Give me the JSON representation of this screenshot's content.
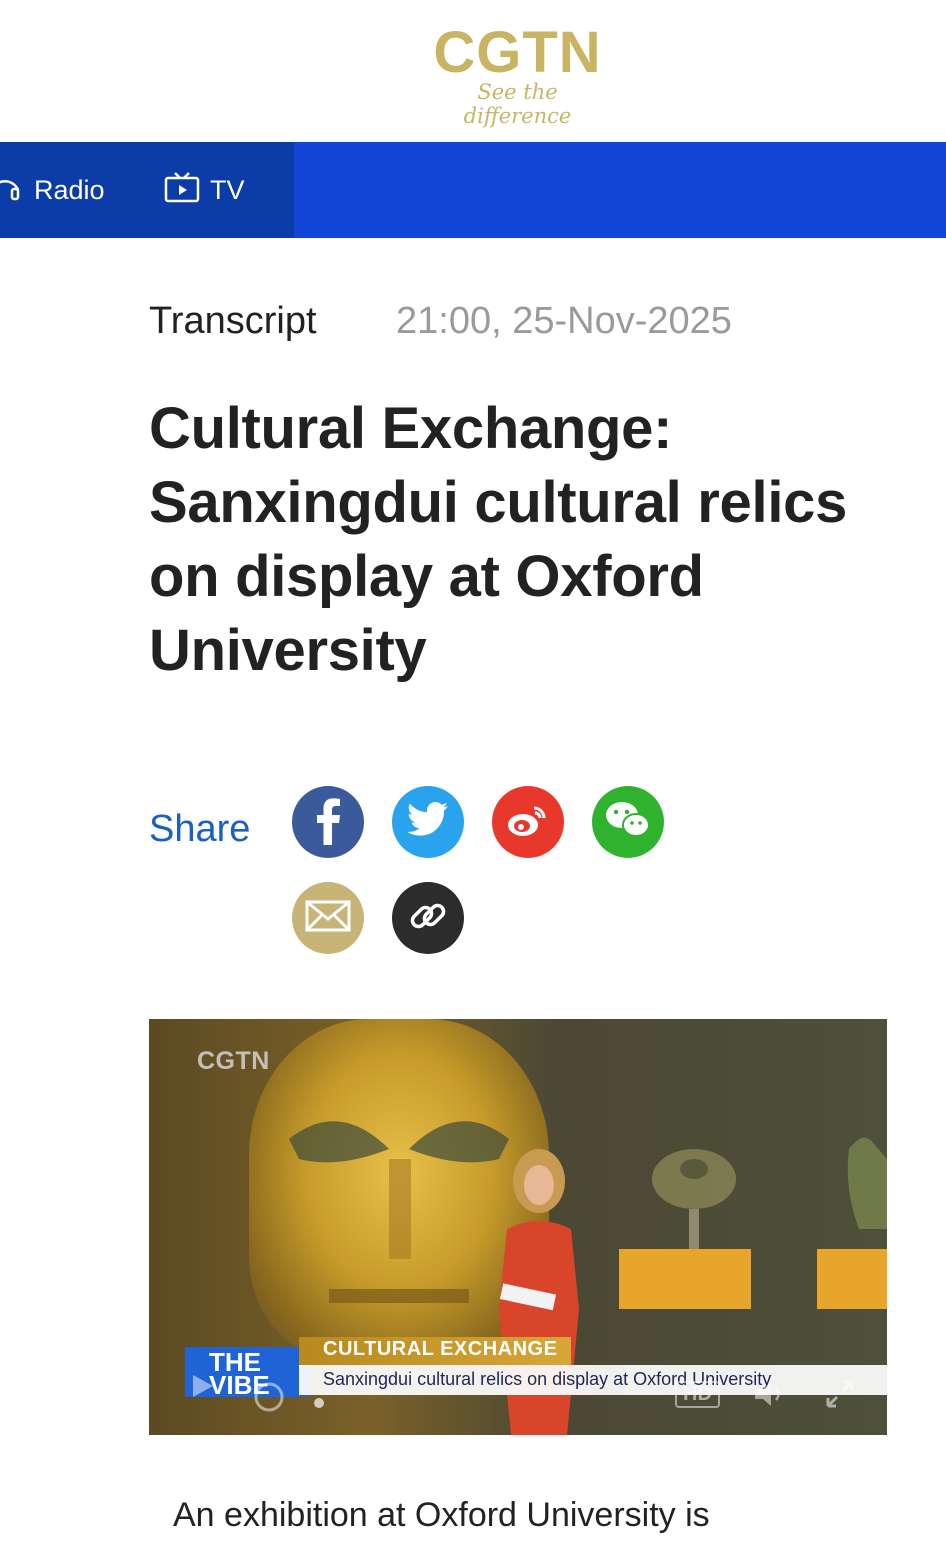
{
  "header": {
    "logo_text": "CGTN",
    "tagline": "See the difference",
    "brand_color": "#c8b462"
  },
  "nav": {
    "items": [
      {
        "label": "Radio",
        "icon": "headphones-icon"
      },
      {
        "label": "TV",
        "icon": "tv-icon"
      }
    ],
    "bar_color": "#1245d6"
  },
  "article": {
    "category": "Transcript",
    "timestamp": "21:00, 25-Nov-2025",
    "title": "Cultural Exchange: Sanxingdui cultural relics on display at Oxford University",
    "share_label": "Share",
    "share_buttons": [
      {
        "name": "facebook",
        "icon": "facebook-icon",
        "color": "#3a5a9c"
      },
      {
        "name": "twitter",
        "icon": "twitter-icon",
        "color": "#2aa3ef"
      },
      {
        "name": "weibo",
        "icon": "weibo-icon",
        "color": "#e8382c"
      },
      {
        "name": "wechat",
        "icon": "wechat-icon",
        "color": "#2fb32f"
      },
      {
        "name": "email",
        "icon": "mail-icon",
        "color": "#c8b477"
      },
      {
        "name": "copy-link",
        "icon": "link-icon",
        "color": "#2c2c2c"
      }
    ],
    "video": {
      "watermark": "CGTN",
      "show_logo": "THE VIBE",
      "lower_third_title": "CULTURAL EXCHANGE",
      "lower_third_subtitle": "Sanxingdui cultural relics on display at Oxford University",
      "quality_badge": "HD"
    },
    "body_start": "An exhibition at Oxford University is"
  }
}
